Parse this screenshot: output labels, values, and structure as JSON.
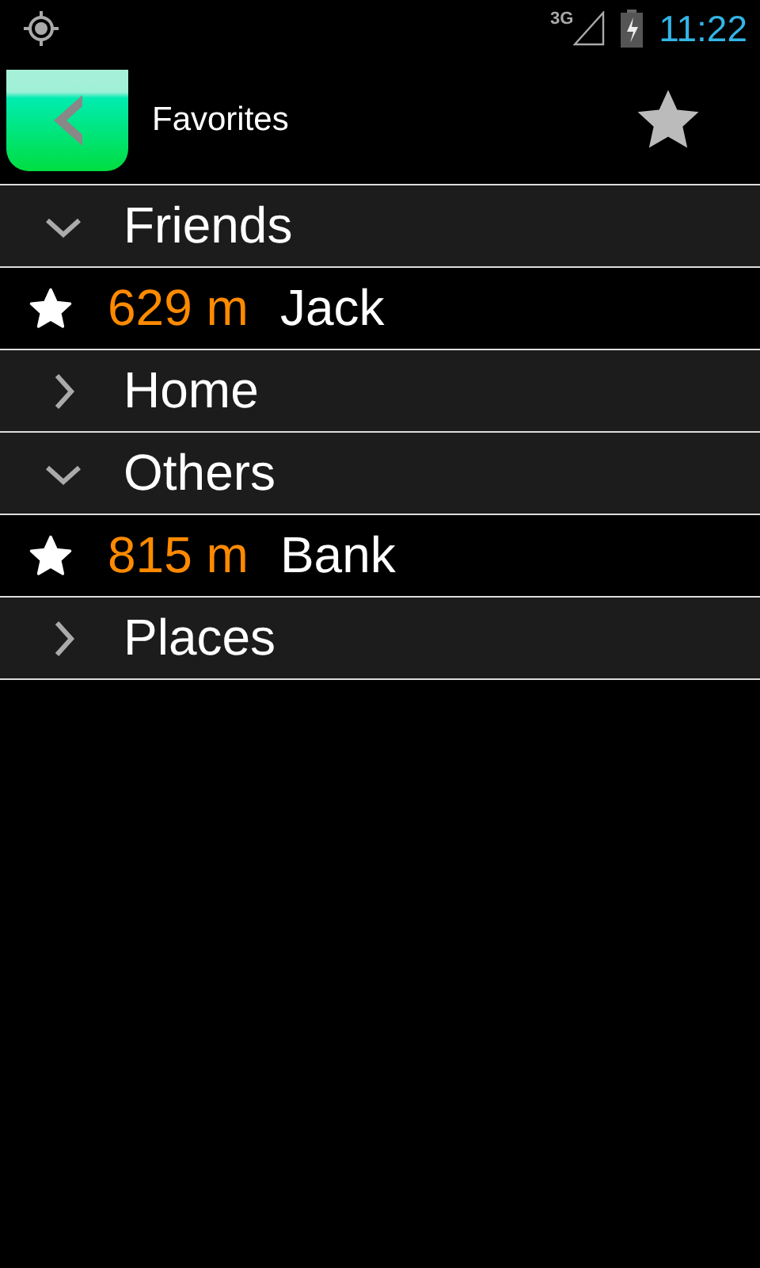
{
  "status_bar": {
    "network": "3G",
    "time": "11:22"
  },
  "header": {
    "title": "Favorites"
  },
  "groups": [
    {
      "name": "Friends",
      "expanded": true,
      "children": [
        {
          "distance": "629 m",
          "name": "Jack"
        }
      ]
    },
    {
      "name": "Home",
      "expanded": false
    },
    {
      "name": "Others",
      "expanded": true,
      "children": [
        {
          "distance": "815 m",
          "name": "Bank"
        }
      ]
    },
    {
      "name": "Places",
      "expanded": false
    }
  ]
}
